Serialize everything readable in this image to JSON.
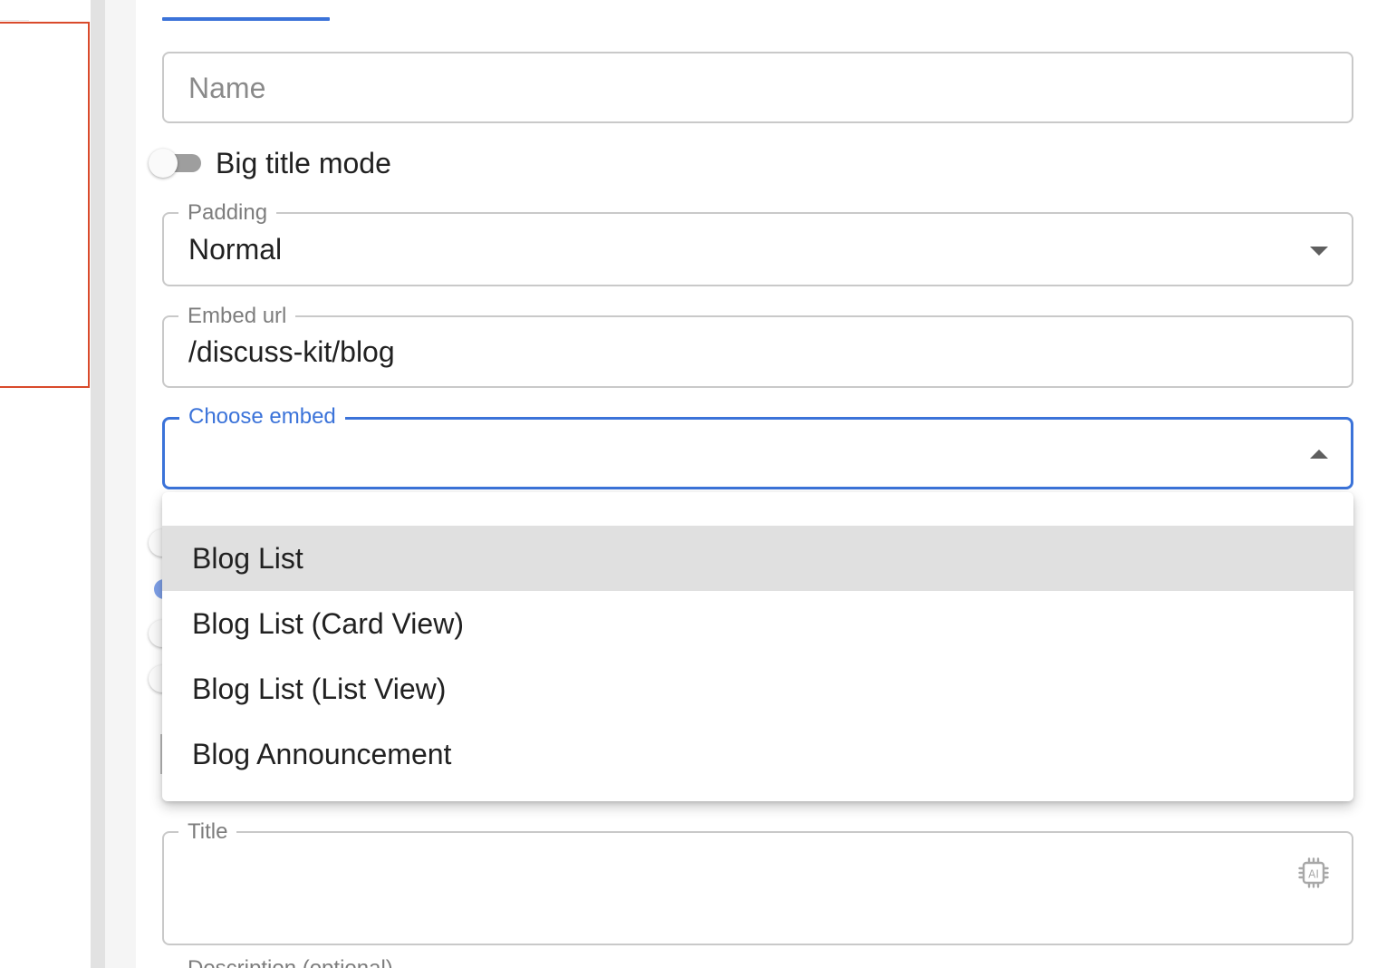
{
  "form": {
    "name_placeholder": "Name",
    "big_title_toggle": {
      "label": "Big title mode",
      "checked": false
    },
    "padding": {
      "label": "Padding",
      "value": "Normal"
    },
    "embed_url": {
      "label": "Embed url",
      "value": "/discuss-kit/blog"
    },
    "choose_embed": {
      "label": "Choose embed",
      "value": "",
      "open": true
    },
    "title_field": {
      "label": "Title",
      "value": ""
    },
    "description_label_partial": "Description (optional)"
  },
  "dropdown": {
    "selected_index": 0,
    "options": [
      {
        "label": "Blog List"
      },
      {
        "label": "Blog List (Card View)"
      },
      {
        "label": "Blog List (List View)"
      },
      {
        "label": "Blog Announcement"
      }
    ]
  },
  "icons": {
    "ai": "ai-chip-icon",
    "padding_caret": "chevron-down-icon",
    "embed_caret": "chevron-up-icon"
  },
  "colors": {
    "accent": "#3b73d9",
    "preview_border": "#d94a2b",
    "menu_selected": "#e0e0e0"
  }
}
